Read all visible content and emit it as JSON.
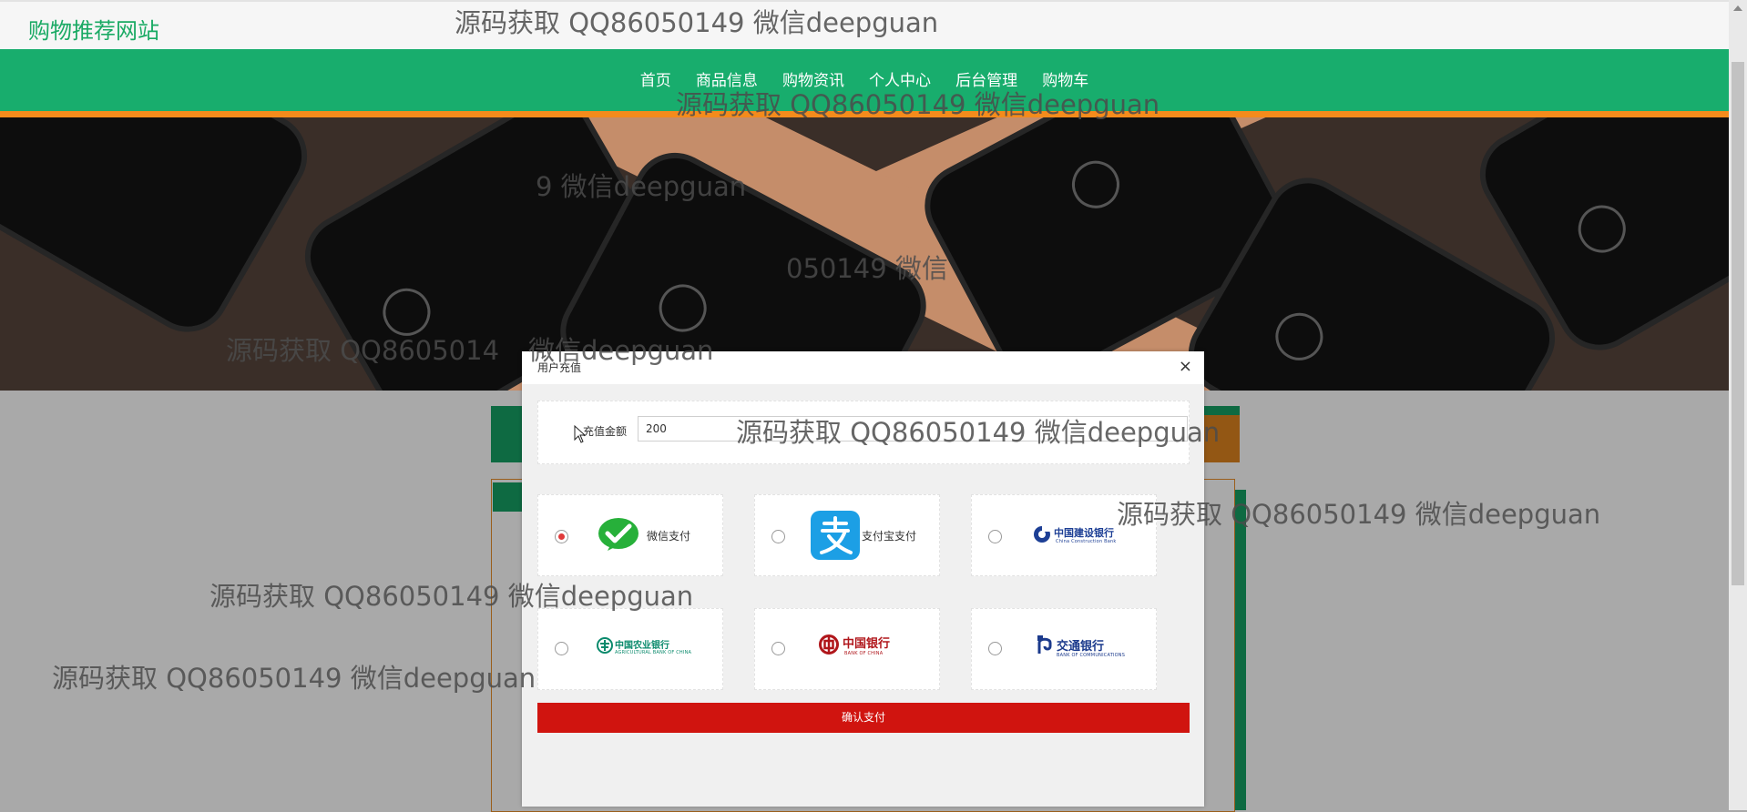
{
  "site": {
    "title": "购物推荐网站"
  },
  "nav": {
    "items": [
      "首页",
      "商品信息",
      "购物资讯",
      "个人中心",
      "后台管理",
      "购物车"
    ]
  },
  "modal": {
    "title": "用户充值",
    "close_glyph": "×",
    "amount_label": "充值金额",
    "amount_value": "200",
    "confirm_label": "确认支付",
    "payments": [
      {
        "label": "微信支付",
        "selected": true,
        "icon": "wechat-pay-icon"
      },
      {
        "label": "支付宝支付",
        "selected": false,
        "icon": "alipay-icon"
      },
      {
        "label": "中国建设银行",
        "sublabel": "China Construction Bank",
        "selected": false,
        "icon": "ccb-logo"
      },
      {
        "label": "中国农业银行",
        "sublabel": "AGRICULTURAL BANK OF CHINA",
        "selected": false,
        "icon": "abc-logo"
      },
      {
        "label": "中国银行",
        "sublabel": "BANK OF CHINA",
        "selected": false,
        "icon": "boc-logo"
      },
      {
        "label": "交通银行",
        "sublabel": "BANK OF COMMUNICATIONS",
        "selected": false,
        "icon": "bocom-logo"
      }
    ]
  },
  "watermarks": [
    "源码获取 QQ86050149 微信deepguan",
    "源码获取 QQ86050149 微信deepguan",
    "9 微信deepguan",
    "050149 微信",
    "源码获取 QQ8605014",
    "微信deepguan",
    "源码获取 QQ86050149 微信deepguan",
    "源码获取 QQ86050149 微信deepguan",
    "源码获取 QQ86050149 微信deepguan",
    "源码获取 QQ86050149 微信deepguan"
  ],
  "colors": {
    "brand_green": "#18ad6d",
    "accent_orange": "#f48b1c",
    "confirm_red": "#d0140f",
    "radio_selected": "#e03a3a"
  }
}
